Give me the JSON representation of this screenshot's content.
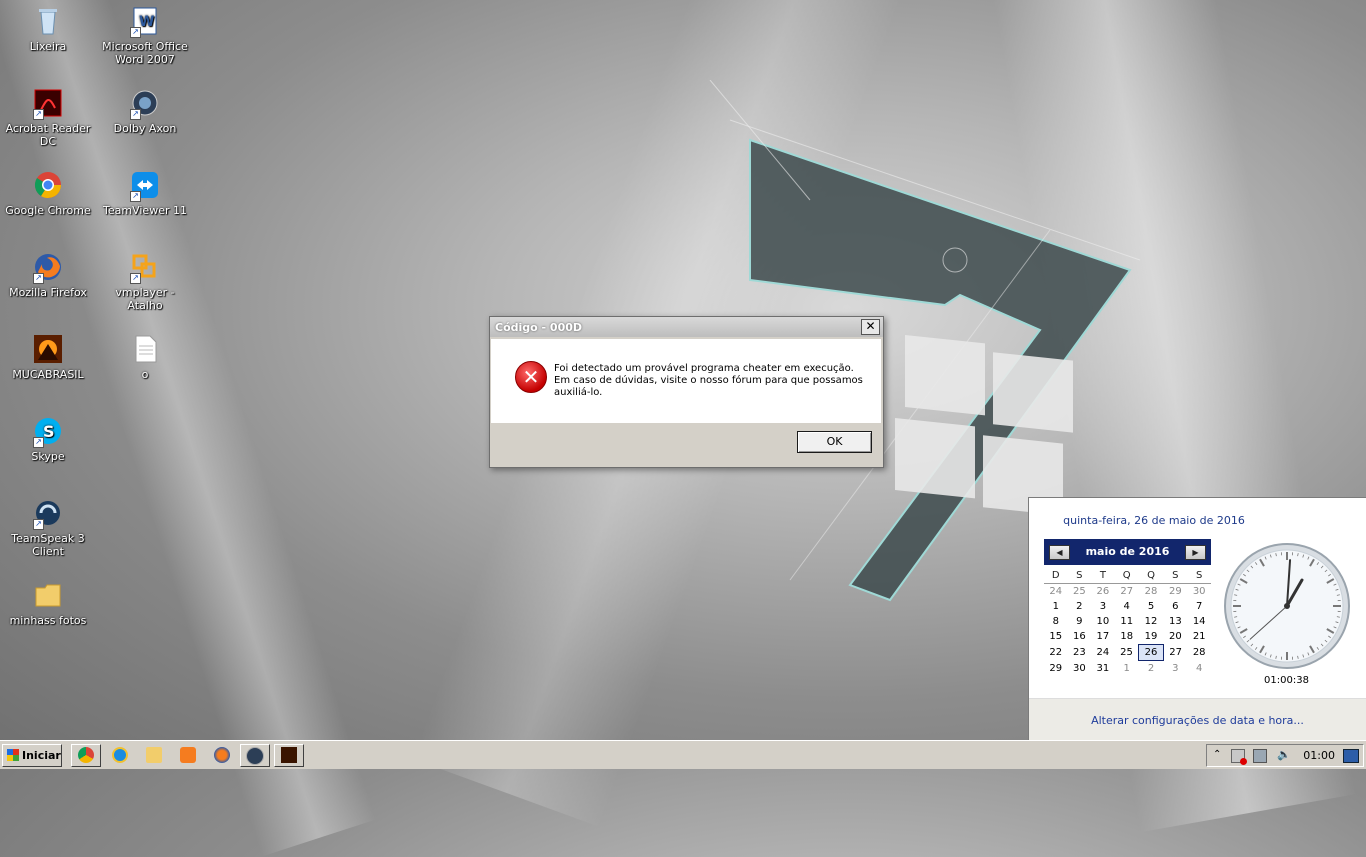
{
  "desktop": {
    "icons": [
      {
        "label": "Lixeira"
      },
      {
        "label": "Microsoft Office Word 2007"
      },
      {
        "label": "Acrobat Reader DC"
      },
      {
        "label": "Dolby Axon"
      },
      {
        "label": "Google Chrome"
      },
      {
        "label": "TeamViewer 11"
      },
      {
        "label": "Mozilla Firefox"
      },
      {
        "label": "vmplayer - Atalho"
      },
      {
        "label": "MUCABRASIL"
      },
      {
        "label": "o"
      },
      {
        "label": "Skype"
      },
      {
        "label": "TeamSpeak 3 Client"
      },
      {
        "label": "minhass fotos"
      }
    ]
  },
  "dialog": {
    "title": "Código - 000D",
    "close_label": "✕",
    "message_line1": "Foi detectado um provável programa cheater em execução.",
    "message_line2": "Em caso de dúvidas, visite o nosso fórum para que possamos auxiliá-lo.",
    "ok_label": "OK",
    "icon": "error-icon"
  },
  "flyout": {
    "long_date": "quinta-feira, 26 de maio de 2016",
    "month_label": "maio de 2016",
    "weekdays": [
      "D",
      "S",
      "T",
      "Q",
      "Q",
      "S",
      "S"
    ],
    "weeks": [
      [
        "24",
        "25",
        "26",
        "27",
        "28",
        "29",
        "30"
      ],
      [
        "1",
        "2",
        "3",
        "4",
        "5",
        "6",
        "7"
      ],
      [
        "8",
        "9",
        "10",
        "11",
        "12",
        "13",
        "14"
      ],
      [
        "15",
        "16",
        "17",
        "18",
        "19",
        "20",
        "21"
      ],
      [
        "22",
        "23",
        "24",
        "25",
        "26",
        "27",
        "28"
      ],
      [
        "29",
        "30",
        "31",
        "1",
        "2",
        "3",
        "4"
      ]
    ],
    "today": "26",
    "time": "01:00:38",
    "clock": {
      "hours": 1,
      "minutes": 0,
      "seconds": 38
    },
    "settings_link": "Alterar configurações de data e hora..."
  },
  "taskbar": {
    "start_label": "Iniciar",
    "clock": "01:00",
    "quick_launch": [
      "chrome-icon",
      "ie-icon",
      "folder-icon",
      "media-player-icon",
      "firefox-icon",
      "dolby-icon",
      "mucabrasil-icon"
    ],
    "tray": [
      "show-hidden-icon",
      "network-error-icon",
      "network-icon",
      "volume-icon",
      "show-desktop-icon"
    ]
  },
  "colors": {
    "calendar_header": "#12266c",
    "link": "#1f3c9b",
    "error_red": "#c40000"
  }
}
